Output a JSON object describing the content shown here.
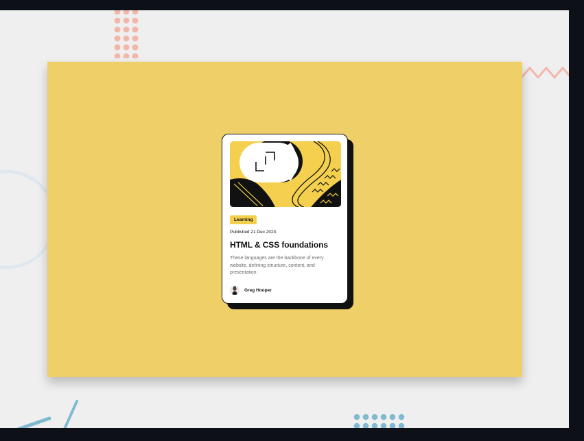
{
  "card": {
    "tag": "Learning",
    "published": "Published 21 Dec 2023",
    "title": "HTML & CSS foundations",
    "description": "These languages are the backbone of every website, defining structure, content, and presentation.",
    "author": "Greg Hooper"
  },
  "colors": {
    "page_background": "#0d1117",
    "viewport_background": "#efefef",
    "stage_background": "#efcf67",
    "tag_background": "#f4d04e",
    "card_shadow": "#111111",
    "pink_decoration": "#f3b7aa",
    "blue_decoration": "#7fbad0"
  },
  "icons": {
    "card_illustration": "abstract-illustration",
    "author_avatar": "avatar"
  }
}
